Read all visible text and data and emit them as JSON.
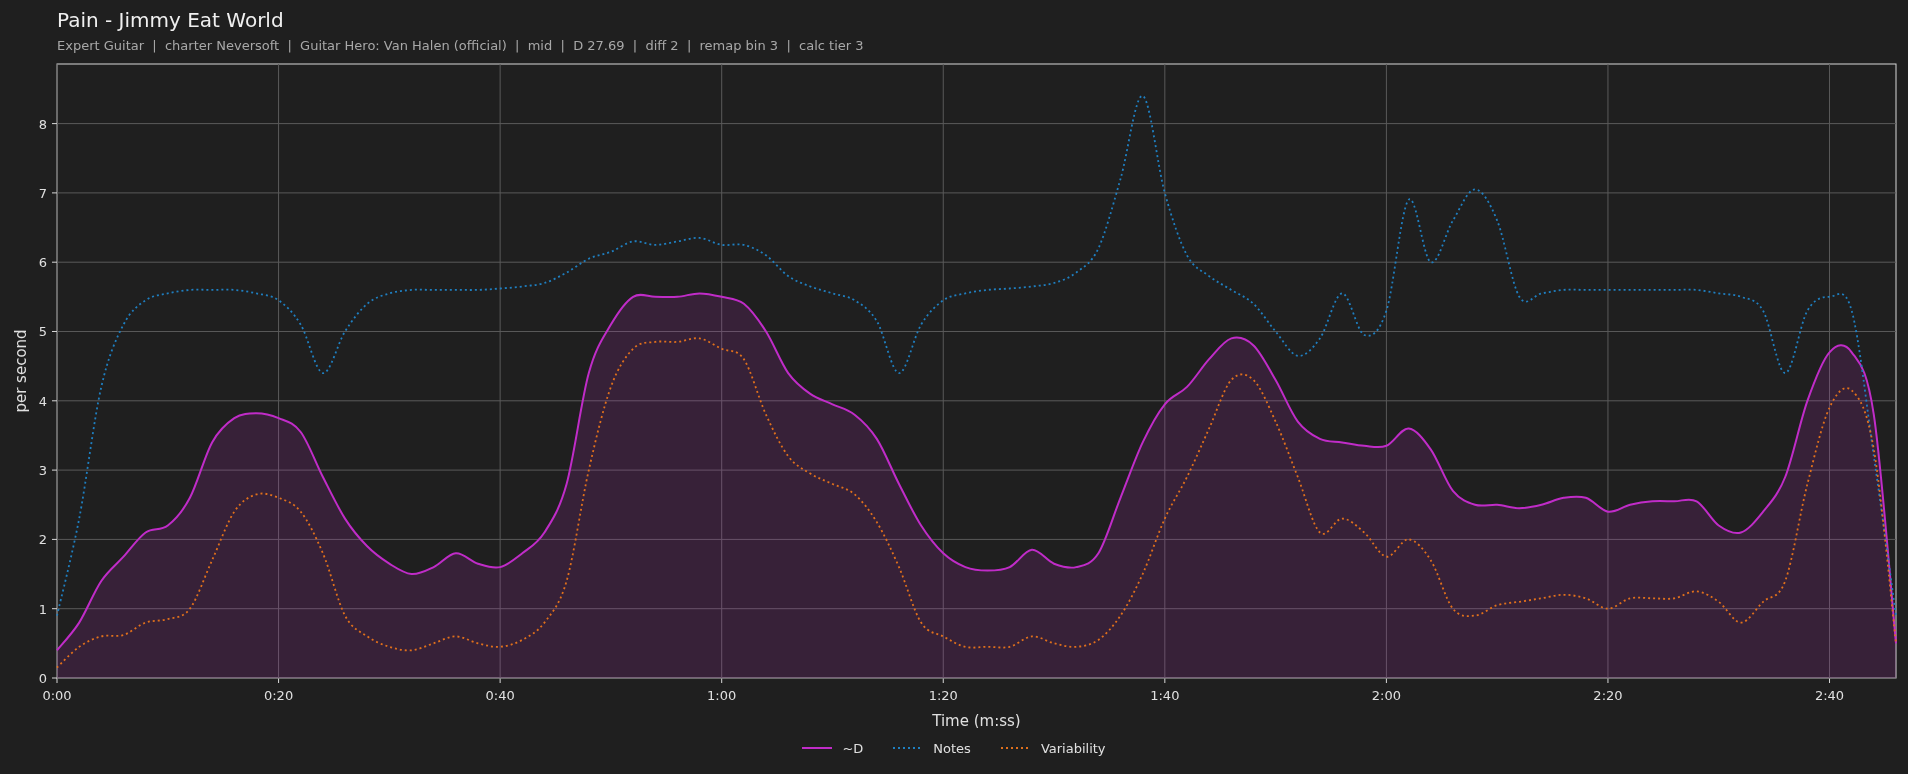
{
  "header": {
    "title": "Pain - Jimmy Eat World",
    "subtitle": "Expert Guitar  |  charter Neversoft  |  Guitar Hero: Van Halen (official)  |  mid  |  D 27.69  |  diff 2  |  remap bin 3  |  calc tier 3"
  },
  "chart": {
    "chart_data": {
      "type": "line",
      "xlabel": "Time (m:ss)",
      "ylabel": "per second",
      "xlim": [
        0,
        166
      ],
      "ylim": [
        0,
        8.86
      ],
      "xticks": [
        {
          "value": 0,
          "label": "0:00"
        },
        {
          "value": 20,
          "label": "0:20"
        },
        {
          "value": 40,
          "label": "0:40"
        },
        {
          "value": 60,
          "label": "1:00"
        },
        {
          "value": 80,
          "label": "1:20"
        },
        {
          "value": 100,
          "label": "1:40"
        },
        {
          "value": 120,
          "label": "2:00"
        },
        {
          "value": 140,
          "label": "2:20"
        },
        {
          "value": 160,
          "label": "2:40"
        }
      ],
      "yticks": [
        0,
        1,
        2,
        3,
        4,
        5,
        6,
        7,
        8
      ],
      "grid": true,
      "x": [
        0,
        2,
        4,
        6,
        8,
        10,
        12,
        14,
        16,
        18,
        20,
        22,
        24,
        26,
        28,
        30,
        32,
        34,
        36,
        38,
        40,
        42,
        44,
        46,
        48,
        50,
        52,
        54,
        56,
        58,
        60,
        62,
        64,
        66,
        68,
        70,
        72,
        74,
        76,
        78,
        80,
        82,
        84,
        86,
        88,
        90,
        92,
        94,
        96,
        98,
        100,
        102,
        104,
        106,
        108,
        110,
        112,
        114,
        116,
        118,
        120,
        122,
        124,
        126,
        128,
        130,
        132,
        134,
        136,
        138,
        140,
        142,
        144,
        146,
        148,
        150,
        152,
        154,
        156,
        158,
        160,
        162,
        164,
        166
      ],
      "series": [
        {
          "name": "~D",
          "color": "#c02cc8",
          "type": "area",
          "line_style": "solid",
          "values": [
            0.4,
            0.8,
            1.4,
            1.75,
            2.1,
            2.2,
            2.6,
            3.4,
            3.75,
            3.82,
            3.75,
            3.55,
            2.9,
            2.3,
            1.9,
            1.65,
            1.5,
            1.6,
            1.8,
            1.65,
            1.6,
            1.8,
            2.1,
            2.8,
            4.4,
            5.1,
            5.5,
            5.5,
            5.5,
            5.55,
            5.5,
            5.4,
            5.0,
            4.4,
            4.1,
            3.95,
            3.8,
            3.45,
            2.8,
            2.2,
            1.8,
            1.6,
            1.55,
            1.6,
            1.85,
            1.65,
            1.6,
            1.8,
            2.6,
            3.4,
            3.95,
            4.2,
            4.6,
            4.9,
            4.8,
            4.3,
            3.7,
            3.45,
            3.4,
            3.35,
            3.35,
            3.6,
            3.3,
            2.7,
            2.5,
            2.5,
            2.45,
            2.5,
            2.6,
            2.6,
            2.4,
            2.5,
            2.55,
            2.55,
            2.55,
            2.2,
            2.1,
            2.4,
            2.9,
            4.0,
            4.7,
            4.7,
            3.8,
            0.5
          ]
        },
        {
          "name": "Notes",
          "color": "#1f7fc0",
          "type": "line",
          "line_style": "dotted",
          "values": [
            0.9,
            2.3,
            4.2,
            5.1,
            5.45,
            5.55,
            5.6,
            5.6,
            5.6,
            5.55,
            5.45,
            5.1,
            4.4,
            5.0,
            5.4,
            5.55,
            5.6,
            5.6,
            5.6,
            5.6,
            5.62,
            5.65,
            5.7,
            5.85,
            6.05,
            6.15,
            6.3,
            6.25,
            6.3,
            6.35,
            6.25,
            6.25,
            6.1,
            5.8,
            5.65,
            5.55,
            5.45,
            5.15,
            4.4,
            5.1,
            5.45,
            5.55,
            5.6,
            5.62,
            5.65,
            5.7,
            5.85,
            6.2,
            7.2,
            8.4,
            7.0,
            6.1,
            5.8,
            5.6,
            5.4,
            5.0,
            4.65,
            4.9,
            5.55,
            4.95,
            5.3,
            6.9,
            6.0,
            6.6,
            7.05,
            6.6,
            5.5,
            5.55,
            5.6,
            5.6,
            5.6,
            5.6,
            5.6,
            5.6,
            5.6,
            5.55,
            5.5,
            5.3,
            4.4,
            5.3,
            5.5,
            5.3,
            3.2,
            0.9
          ]
        },
        {
          "name": "Variability",
          "color": "#e0701c",
          "type": "line",
          "line_style": "dotted",
          "values": [
            0.15,
            0.45,
            0.6,
            0.62,
            0.8,
            0.85,
            1.0,
            1.7,
            2.4,
            2.65,
            2.6,
            2.4,
            1.8,
            0.9,
            0.6,
            0.45,
            0.4,
            0.5,
            0.6,
            0.5,
            0.45,
            0.55,
            0.8,
            1.4,
            3.0,
            4.2,
            4.75,
            4.85,
            4.85,
            4.9,
            4.75,
            4.6,
            3.8,
            3.2,
            2.95,
            2.8,
            2.65,
            2.25,
            1.6,
            0.8,
            0.6,
            0.45,
            0.45,
            0.45,
            0.6,
            0.5,
            0.45,
            0.55,
            0.9,
            1.5,
            2.3,
            2.9,
            3.6,
            4.3,
            4.3,
            3.7,
            2.9,
            2.1,
            2.3,
            2.1,
            1.75,
            2.0,
            1.7,
            1.0,
            0.9,
            1.05,
            1.1,
            1.15,
            1.2,
            1.15,
            1.0,
            1.15,
            1.15,
            1.15,
            1.25,
            1.1,
            0.8,
            1.1,
            1.4,
            2.8,
            3.9,
            4.15,
            3.3,
            0.5
          ]
        }
      ]
    }
  }
}
